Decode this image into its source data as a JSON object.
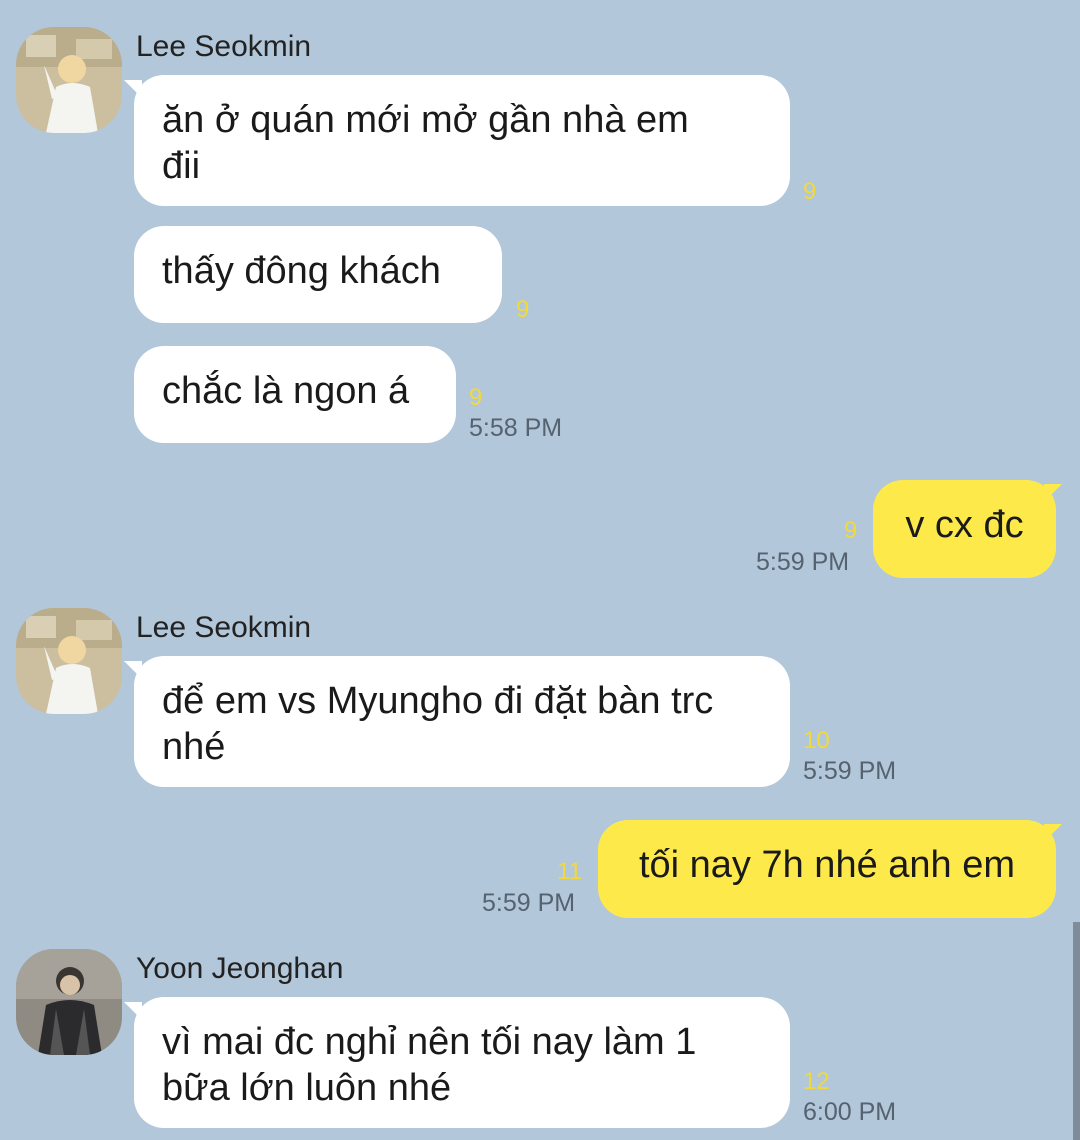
{
  "chat": {
    "messages": [
      {
        "sender": "Lee Seokmin",
        "lines": "ăn ở quán mới mở gần nhà em\nđii",
        "unread": "9",
        "time": ""
      },
      {
        "sender": "",
        "lines": "thấy đông khách",
        "unread": "9",
        "time": ""
      },
      {
        "sender": "",
        "lines": "chắc là ngon á",
        "unread": "9",
        "time": "5:58 PM"
      },
      {
        "sender": "me",
        "lines": "v cx đc",
        "unread": "9",
        "time": "5:59 PM"
      },
      {
        "sender": "Lee Seokmin",
        "lines": "để em vs Myungho đi đặt bàn trc\nnhé",
        "unread": "10",
        "time": "5:59 PM"
      },
      {
        "sender": "me",
        "lines": "tối nay 7h nhé anh em",
        "unread": "11",
        "time": "5:59 PM"
      },
      {
        "sender": "Yoon Jeonghan",
        "lines": "vì mai đc nghỉ nên tối nay làm 1\nbữa lớn luôn nhé",
        "unread": "12",
        "time": "6:00 PM"
      }
    ]
  },
  "colors": {
    "background": "#b2c7da",
    "incoming_bubble": "#ffffff",
    "outgoing_bubble": "#fee94b",
    "unread_count": "#f2d93a"
  },
  "icons": {
    "avatar_seokmin": "profile-photo-avatar",
    "avatar_jeonghan": "profile-photo-avatar"
  }
}
